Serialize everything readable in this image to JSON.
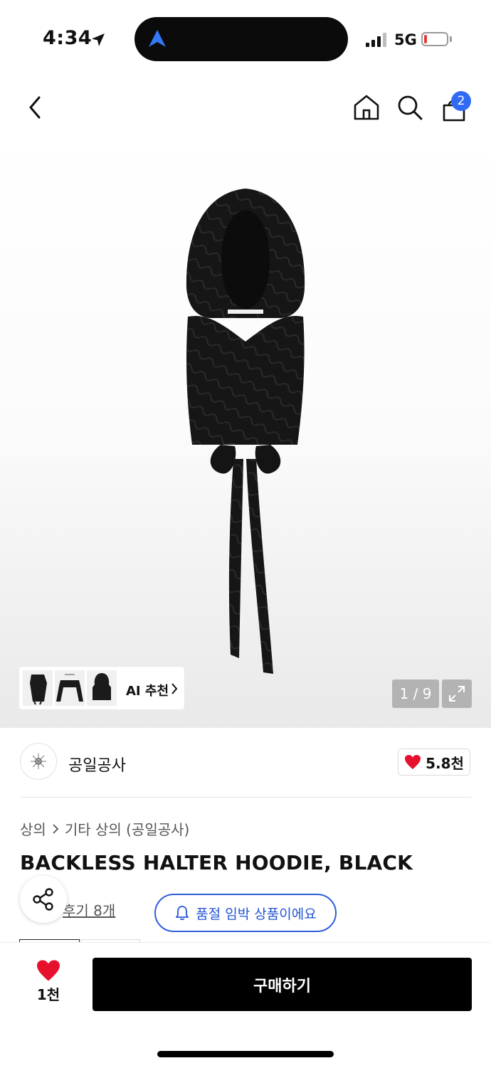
{
  "status_bar": {
    "time": "4:34",
    "network": "5G",
    "battery_level": 0.08,
    "colors": {
      "battery_low": "#e23a3a",
      "nav_arrow": "#3478f6"
    }
  },
  "nav": {
    "cart_count": "2",
    "badge_color": "#2f6bf5"
  },
  "gallery": {
    "counter": "1 / 9",
    "ai_recommend_label": "AI 추천"
  },
  "brand": {
    "name": "공일공사",
    "likes": "5.8천",
    "heart_color": "#e8112d"
  },
  "breadcrumb": {
    "level1": "상의",
    "level2": "기타 상의 (공일공사)"
  },
  "product": {
    "title": "BACKLESS HALTER HOODIE, BLACK",
    "review_label": "후기 8개"
  },
  "stock_alert": {
    "label": "품절 임박 상품이에요",
    "color": "#2454d6"
  },
  "bottom_bar": {
    "like_count": "1천",
    "buy_label": "구매하기"
  }
}
